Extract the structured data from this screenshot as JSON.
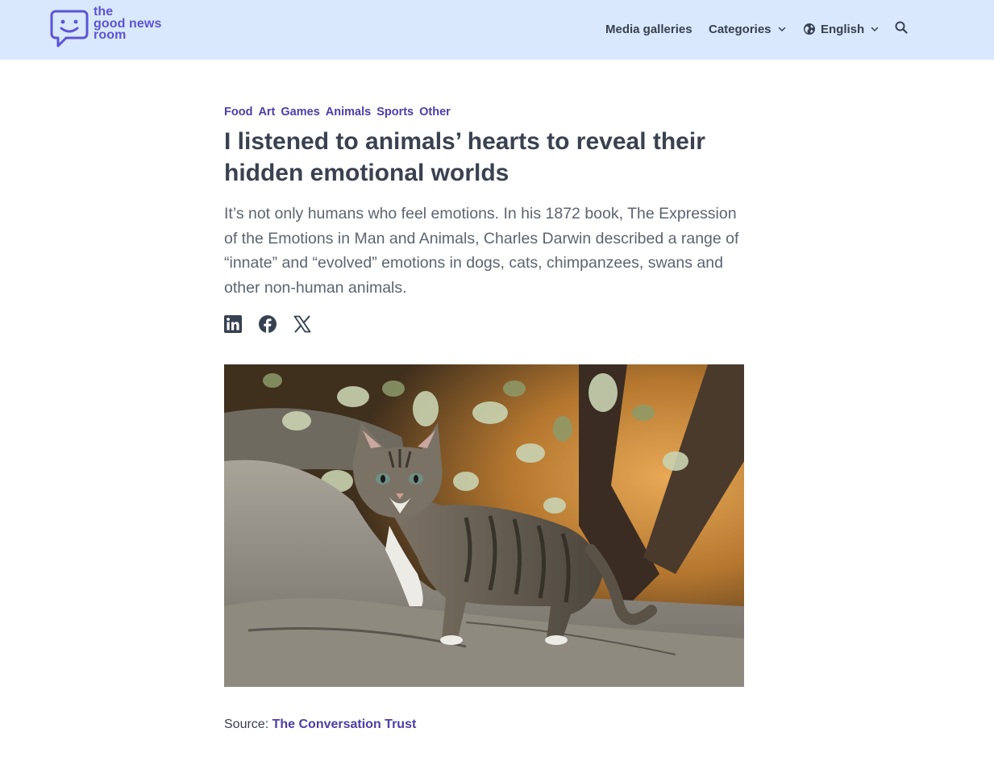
{
  "header": {
    "logo": {
      "lines": [
        "the",
        "good news",
        "room"
      ],
      "icon": "chat-smiley-icon",
      "color": "#5b54d6"
    },
    "nav": {
      "media_galleries": "Media galleries",
      "categories": "Categories",
      "language": "English",
      "search_icon": "search-icon"
    },
    "background": "#d9e8fc"
  },
  "article": {
    "tags": [
      "Food",
      "Art",
      "Games",
      "Animals",
      "Sports",
      "Other"
    ],
    "title": "I listened to animals’ hearts to reveal their hidden emotional worlds",
    "lede": "It’s not only humans who feel emotions. In his 1872 book, The Expression of the Emotions in Man and Animals, Charles Darwin described a range of “innate” and “evolved” emotions in dogs, cats, chimpanzees, swans and other non-human animals.",
    "share": [
      "linkedin-icon",
      "facebook-icon",
      "x-icon"
    ],
    "image_alt": "Tabby kitten on a rock",
    "source_label": "Source:",
    "source_link": "The Conversation Trust",
    "accent": "#4c3ea6"
  }
}
